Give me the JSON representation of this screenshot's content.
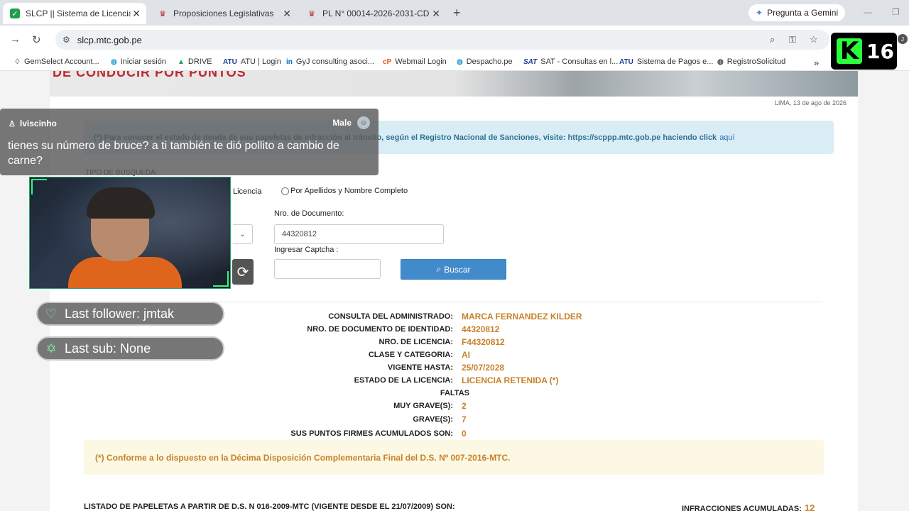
{
  "browser": {
    "tabs": [
      {
        "label": "SLCP || Sistema de Licencias de",
        "icon": "shield-check-icon",
        "active": true
      },
      {
        "label": "Proposiciones Legislativas",
        "icon": "congress-icon",
        "active": false
      },
      {
        "label": "PL N° 00014-2026-2031-CD",
        "icon": "congress-icon",
        "active": false
      }
    ],
    "gemini_label": "Pregunta a Gemini",
    "url": "slcp.mtc.gob.pe",
    "profile_initial": "J",
    "bookmarks": [
      {
        "label": "GemSelect Account...",
        "icon": "gemselect-icon"
      },
      {
        "label": "Iniciar sesión",
        "icon": "globe-icon"
      },
      {
        "label": "DRIVE",
        "icon": "drive-icon"
      },
      {
        "label": "ATU | Login",
        "icon": "atu-icon"
      },
      {
        "label": "GyJ consulting asoci...",
        "icon": "linkedin-icon"
      },
      {
        "label": "Webmail Login",
        "icon": "cpanel-icon"
      },
      {
        "label": "Despacho.pe",
        "icon": "globe-icon"
      },
      {
        "label": "SAT - Consultas en l...",
        "icon": "sat-icon"
      },
      {
        "label": "Sistema de Pagos e...",
        "icon": "atu-icon"
      },
      {
        "label": "RegistroSolicitud",
        "icon": "globe-icon"
      }
    ],
    "badge": {
      "letter": "K",
      "number": "16"
    }
  },
  "page": {
    "banner_text": "DE CONDUCIR POR PUNTOS",
    "date": "LIMA, 13 de ago de 2026",
    "info_alert": "(*) Para conocer el estado de deuda de sus papeletas de infracción al tránsito, según el Registro Nacional de Sanciones, visite: https://scppp.mtc.gob.pe haciendo click",
    "info_link": "aquí",
    "search_type_label": "TIPO DE BUSQUEDA:",
    "radio_licencia": "Licencia",
    "radio_apellidos": "Por Apellidos y Nombre Completo",
    "doc_label": "Nro. de Documento:",
    "doc_value": "44320812",
    "captcha_label": "Ingresar Captcha :",
    "search_button": "Buscar",
    "results": [
      {
        "label": "CONSULTA DEL ADMINISTRADO:",
        "value": "MARCA FERNANDEZ KILDER"
      },
      {
        "label": "NRO. DE DOCUMENTO DE IDENTIDAD:",
        "value": "44320812"
      },
      {
        "label": "NRO. DE LICENCIA:",
        "value": "F44320812"
      },
      {
        "label": "CLASE Y CATEGORIA:",
        "value": "AI"
      },
      {
        "label": "VIGENTE HASTA:",
        "value": "25/07/2028"
      },
      {
        "label": "ESTADO DE LA LICENCIA:",
        "value": "LICENCIA RETENIDA (*)"
      },
      {
        "label": "FALTAS",
        "value": ""
      },
      {
        "label": "MUY GRAVE(S):",
        "value": "2"
      },
      {
        "label": "GRAVE(S):",
        "value": "7"
      },
      {
        "label": "SUS PUNTOS FIRMES ACUMULADOS SON:",
        "value": "0"
      }
    ],
    "warn_alert": "(*) Conforme a lo dispuesto en la Décima Disposición Complementaria Final del D.S. Nº 007-2016-MTC.",
    "listado_label": "LISTADO DE PAPELETAS A PARTIR DE D.S. N 016-2009-MTC (VIGENTE DESDE EL 21/07/2009) SON:",
    "infracciones_label": "INFRACCIONES ACUMULADAS:",
    "infracciones_value": "12"
  },
  "overlay": {
    "chat_user": "lviscinho",
    "chat_gender": "Male",
    "chat_message": "tienes su número de bruce? a ti también te dió pollito a cambio de carne?",
    "last_follower": "Last follower: jmtak",
    "last_sub": "Last sub: None"
  },
  "colors": {
    "accent_value": "#c8812a",
    "info_bg": "#d9edf7",
    "warn_bg": "#fcf8e3",
    "button_blue": "#428bca",
    "badge_green": "#2aff3c"
  }
}
